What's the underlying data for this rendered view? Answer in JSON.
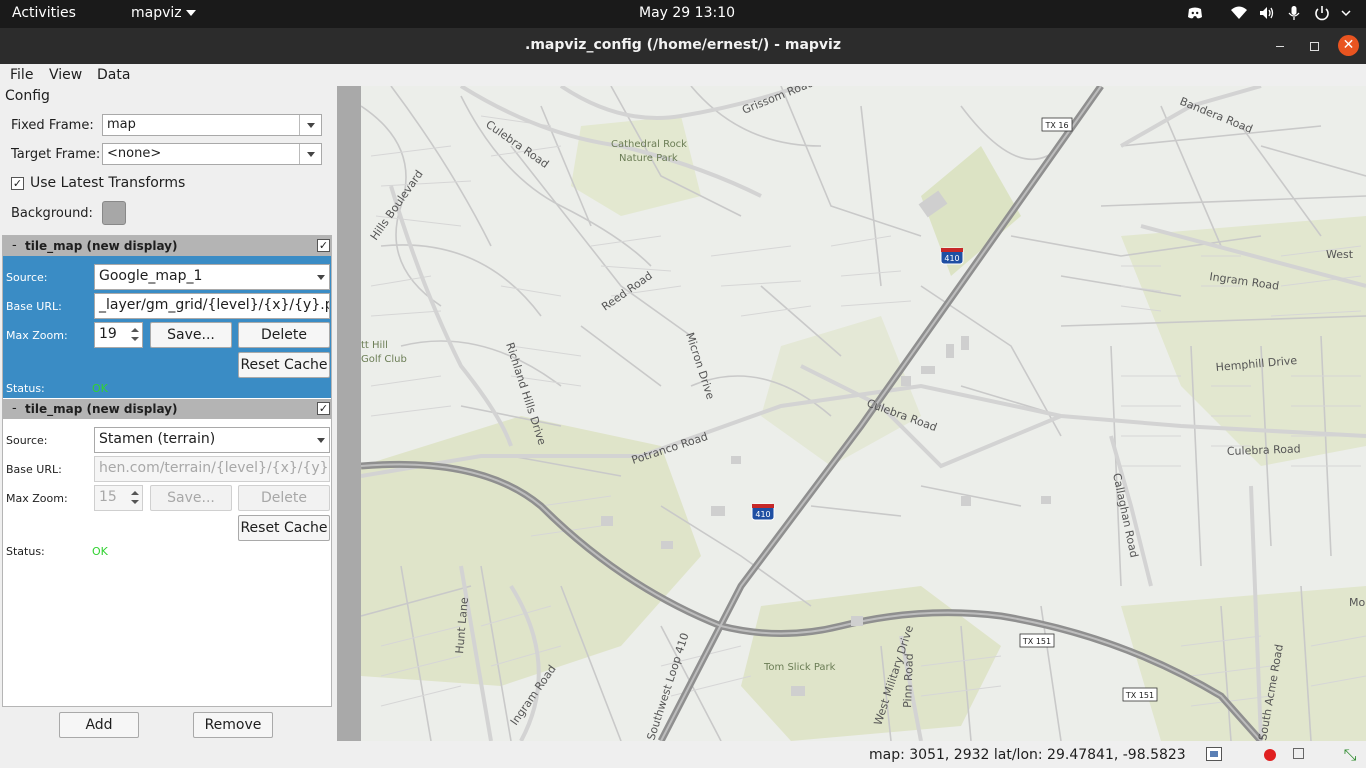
{
  "topbar": {
    "activities": "Activities",
    "app_menu": "mapviz",
    "clock": "May 29  13:10"
  },
  "window": {
    "title": ".mapviz_config (/home/ernest/) - mapviz"
  },
  "menubar": {
    "file": "File",
    "view": "View",
    "data": "Data"
  },
  "config": {
    "heading": "Config",
    "fixed_frame_label": "Fixed Frame:",
    "fixed_frame_value": "map",
    "target_frame_label": "Target Frame:",
    "target_frame_value": "<none>",
    "use_latest_label": "Use Latest Transforms",
    "use_latest_checked": true,
    "background_label": "Background:",
    "background_color": "#a7a7a7"
  },
  "displays": [
    {
      "minus": "-",
      "name": "tile_map (new display)",
      "enabled": true,
      "source_label": "Source:",
      "source": "Google_map_1",
      "base_url_label": "Base URL:",
      "base_url": "_layer/gm_grid/{level}/{x}/{y}.png",
      "max_zoom_label": "Max Zoom:",
      "max_zoom": "19",
      "save": "Save...",
      "delete": "Delete",
      "reset_cache": "Reset Cache",
      "status_label": "Status:",
      "status": "OK"
    },
    {
      "minus": "-",
      "name": "tile_map (new display)",
      "enabled": true,
      "source_label": "Source:",
      "source": "Stamen (terrain)",
      "base_url_label": "Base URL:",
      "base_url": "hen.com/terrain/{level}/{x}/{y}.png",
      "max_zoom_label": "Max Zoom:",
      "max_zoom": "15",
      "save": "Save...",
      "delete": "Delete",
      "reset_cache": "Reset Cache",
      "status_label": "Status:",
      "status": "OK"
    }
  ],
  "buttons": {
    "add": "Add",
    "remove": "Remove"
  },
  "map": {
    "labels": {
      "culebra_road_nw": "Culebra Road",
      "grissom_road": "Grissom Road",
      "cathedral_rock_1": "Cathedral Rock",
      "cathedral_rock_2": "Nature Park",
      "bandera_road": "Bandera Road",
      "tx16": "TX 16",
      "hills_boulevard": "Hills Boulevard",
      "i410": "410",
      "west": "West",
      "ingram_road_ne": "Ingram Road",
      "reed_road": "Reed Road",
      "hill_golf_1": "tt Hill",
      "hill_golf_2": "Golf Club",
      "richland_hills": "Richland Hills Drive",
      "micron_drive": "Micron Drive",
      "hemphill_drive": "Hemphill Drive",
      "culebra_road_mid": "Culebra Road",
      "culebra_road_e": "Culebra Road",
      "potranco_road": "Potranco Road",
      "callaghan_road": "Callaghan Road",
      "hunt_lane": "Hunt Lane",
      "loop_410": "Southwest Loop 410",
      "ingram_road_sw": "Ingram Road",
      "tx151_a": "TX 151",
      "tx151_b": "TX 151",
      "tom_slick_park": "Tom Slick Park",
      "west_military": "West Military Drive",
      "pinn_road": "Pinn Road",
      "south_acme": "South Acme Road",
      "mo": "Mo"
    }
  },
  "statusbar": {
    "coords": "map: 3051, 2932  lat/lon: 29.47841, -98.5823"
  },
  "colors": {
    "selected_display": "#3a8cc5",
    "status_ok": "#32d232",
    "close_button": "#e95420"
  },
  "icons": [
    "discord-icon",
    "wifi-icon",
    "volume-icon",
    "microphone-icon",
    "power-icon",
    "screenshot-icon",
    "record-icon",
    "stop-icon",
    "fit-icon"
  ]
}
